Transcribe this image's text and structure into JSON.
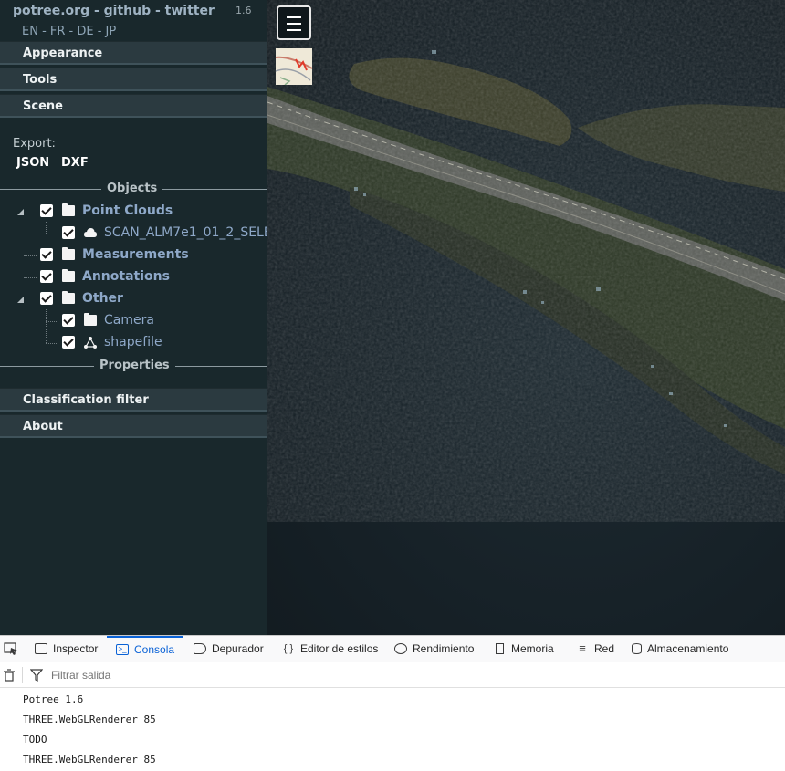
{
  "sidebar": {
    "title": "potree.org - github - twitter",
    "version": "1.6",
    "languages": "EN - FR - DE - JP",
    "menus": {
      "appearance": "Appearance",
      "tools": "Tools",
      "scene": "Scene",
      "classification": "Classification filter",
      "about": "About"
    },
    "export_label": "Export:",
    "export_json": "JSON",
    "export_dxf": "DXF",
    "objects_label": "Objects",
    "properties_label": "Properties",
    "tree": {
      "point_clouds": "Point Clouds",
      "scan": "SCAN_ALM7e1_01_2_SELE",
      "measurements": "Measurements",
      "annotations": "Annotations",
      "other": "Other",
      "camera": "Camera",
      "shapefile": "shapefile"
    }
  },
  "viewer": {
    "menu_icon": "hamburger-icon",
    "minimap_icon": "minimap"
  },
  "devtools": {
    "tabs": [
      {
        "label": "Inspector",
        "icon": "inspector-icon"
      },
      {
        "label": "Consola",
        "icon": "console-icon"
      },
      {
        "label": "Depurador",
        "icon": "debugger-icon"
      },
      {
        "label": "Editor de estilos",
        "icon": "style-editor-icon"
      },
      {
        "label": "Rendimiento",
        "icon": "performance-icon"
      },
      {
        "label": "Memoria",
        "icon": "memory-icon"
      },
      {
        "label": "Red",
        "icon": "network-icon"
      },
      {
        "label": "Almacenamiento",
        "icon": "storage-icon"
      }
    ],
    "filter_placeholder": "Filtrar salida",
    "console_lines": [
      "Potree 1.6",
      "THREE.WebGLRenderer 85",
      "TODO",
      "THREE.WebGLRenderer 85"
    ]
  },
  "colors": {
    "sidebar_bg": "#19282c",
    "menu_bg": "#2b3a40",
    "active_tab": "#0a62d6",
    "tree_label": "#8ea8c8"
  }
}
